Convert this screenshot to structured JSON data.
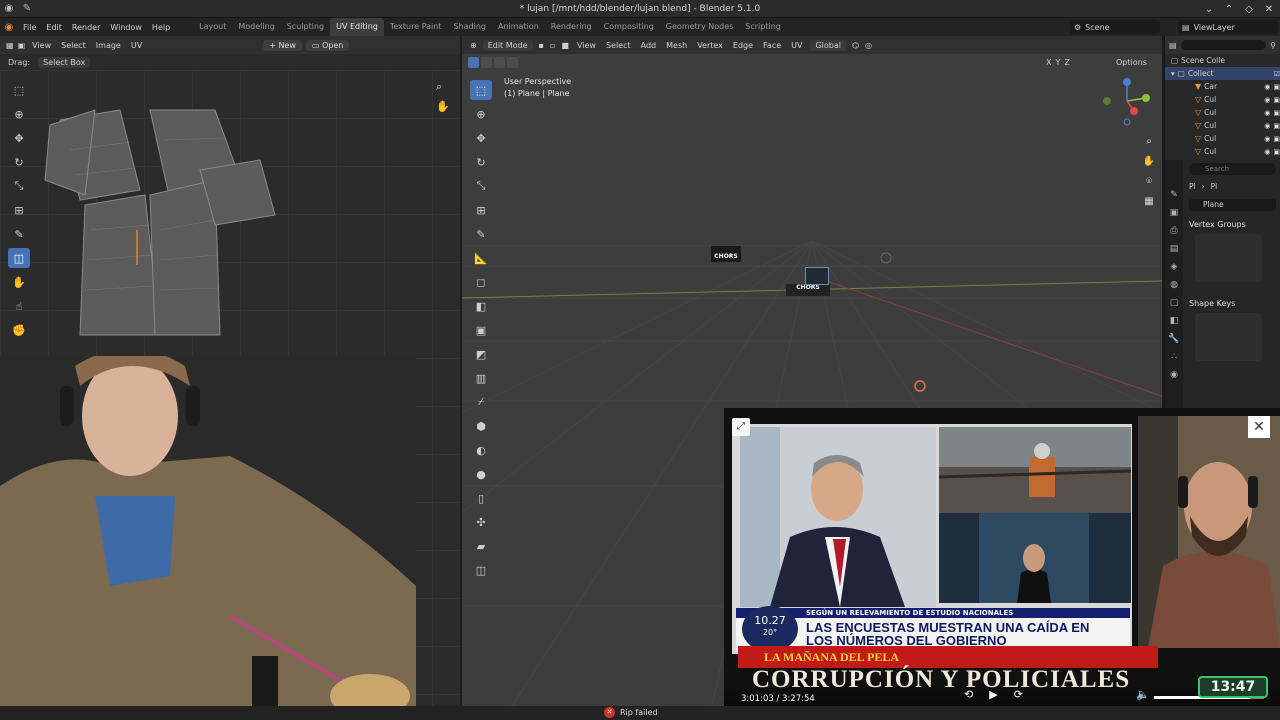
{
  "window": {
    "title": "* lujan [/mnt/hdd/blender/lujan.blend] - Blender 5.1.0"
  },
  "menu": {
    "items": [
      "File",
      "Edit",
      "Render",
      "Window",
      "Help"
    ],
    "workspaces": [
      "Layout",
      "Modeling",
      "Sculpting",
      "UV Editing",
      "Texture Paint",
      "Shading",
      "Animation",
      "Rendering",
      "Compositing",
      "Geometry Nodes",
      "Scripting"
    ],
    "active_workspace": "UV Editing",
    "scene": "Scene",
    "view_layer": "ViewLayer"
  },
  "uv_editor": {
    "menus": [
      "View",
      "Select",
      "Image",
      "UV"
    ],
    "new_label": "New",
    "open_label": "Open",
    "drag_label": "Drag:",
    "drag_value": "Select Box"
  },
  "viewport": {
    "mode": "Edit Mode",
    "menus": [
      "View",
      "Select",
      "Add",
      "Mesh",
      "Vertex",
      "Edge",
      "Face",
      "UV"
    ],
    "orientation": "Global",
    "options_label": "Options",
    "info_line1": "User Perspective",
    "info_line2": "(1) Plane | Plane",
    "axis_labels": [
      "X",
      "Y",
      "Z"
    ],
    "decal_text": "CHORS"
  },
  "outliner": {
    "title": "Scene Colle",
    "collection": "Collect",
    "rows": [
      "Car",
      "Cul",
      "Cul",
      "Cul",
      "Cul",
      "Cul"
    ]
  },
  "properties": {
    "search_placeholder": "Search",
    "object_name": "Pl",
    "data_name": "Pl",
    "mesh_name": "Plane",
    "panel_vertex_groups": "Vertex Groups",
    "panel_shape_keys": "Shape Keys"
  },
  "overlay": {
    "news_strip": "SEGÚN UN RELEVAMIENTO DE ESTUDIO NACIONALES",
    "news_headline_1": "LAS ENCUESTAS MUESTRAN UNA CAÍDA EN",
    "news_headline_2": "LOS NÚMEROS DEL GOBIERNO",
    "news_clock_time": "10.27",
    "news_clock_temp": "20°",
    "show_name": "LA MAÑANA DEL PELA",
    "show_title": "CORRUPCIÓN Y POLICIALES",
    "clock_overlay": "13:47",
    "player_time": "3:01:03 / 3:27:54",
    "progress_fraction": 0.87
  },
  "status": {
    "message": "Rip failed"
  },
  "colors": {
    "accent": "#4772b3",
    "error": "#d0332b"
  }
}
